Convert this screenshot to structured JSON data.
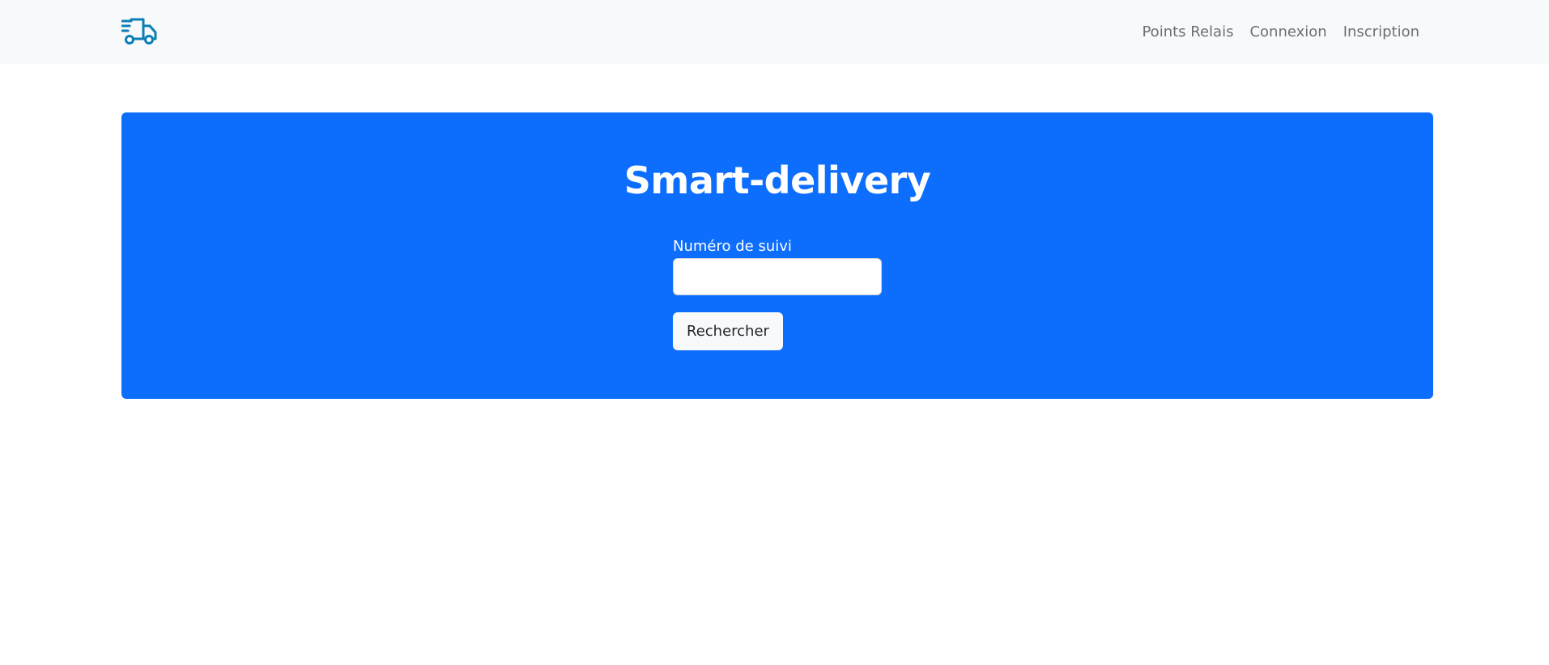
{
  "navbar": {
    "logo_icon": "delivery-truck-icon",
    "logo_color": "#0a7fb5",
    "background": "#f8f9fa",
    "links": [
      {
        "label": "Points Relais"
      },
      {
        "label": "Connexion"
      },
      {
        "label": "Inscription"
      }
    ]
  },
  "hero": {
    "background": "#0d6efd",
    "title": "Smart-delivery",
    "form": {
      "tracking_label": "Numéro de suivi",
      "tracking_value": "",
      "search_button_label": "Rechercher"
    }
  }
}
